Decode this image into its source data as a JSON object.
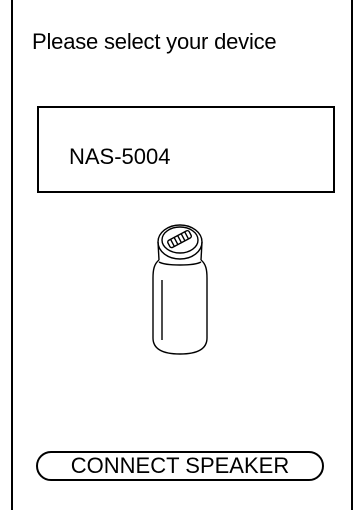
{
  "screen": {
    "title": "Please select  your device"
  },
  "device": {
    "name": "NAS-5004",
    "icon": "cylindrical-speaker-icon"
  },
  "actions": {
    "connect_label": "CONNECT SPEAKER"
  }
}
